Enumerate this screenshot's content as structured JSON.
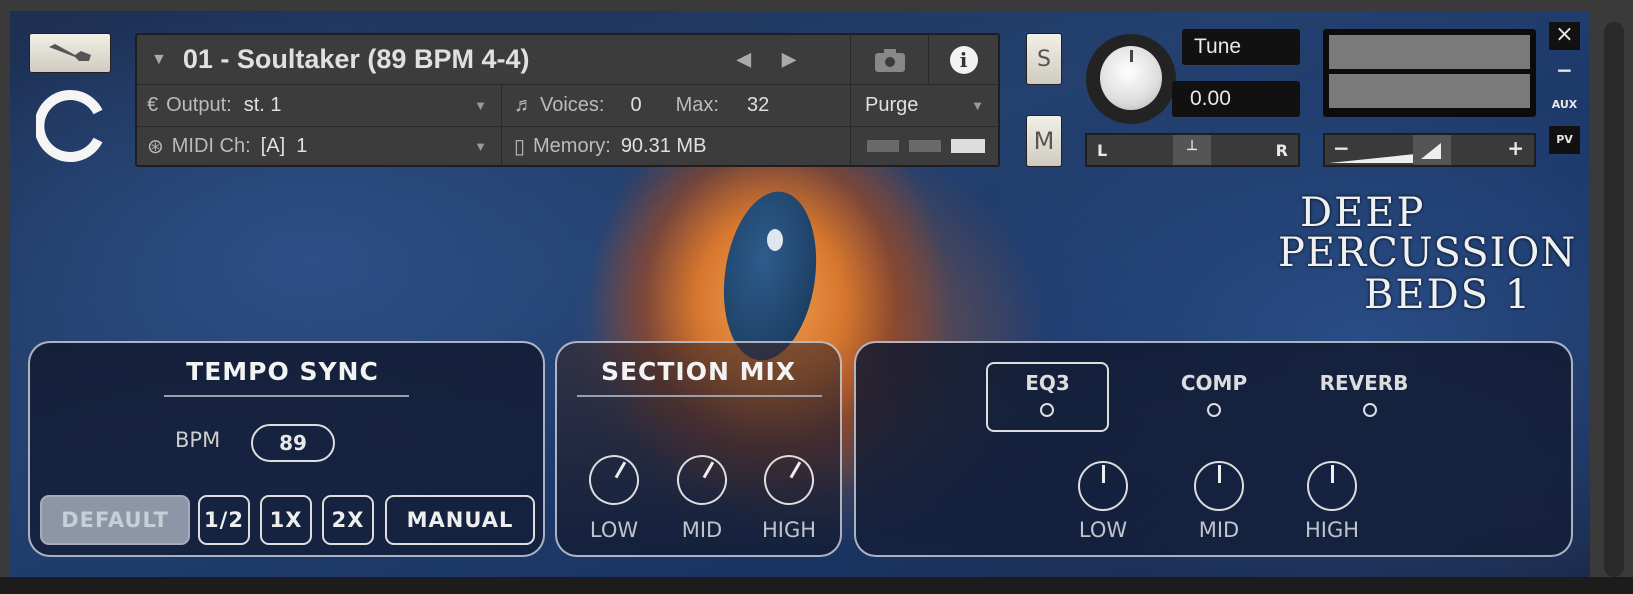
{
  "header": {
    "preset": "01 - Soultaker (89 BPM 4-4)",
    "output_label": "Output:",
    "output_value": "st. 1",
    "voices_label": "Voices:",
    "voices_value": "0",
    "max_label": "Max:",
    "max_value": "32",
    "purge": "Purge",
    "midi_label": "MIDI Ch:",
    "midi_value": "[A]  1",
    "memory_label": "Memory:",
    "memory_value": "90.31 MB"
  },
  "controls": {
    "solo": "S",
    "mute": "M",
    "tune_label": "Tune",
    "tune_value": "0.00",
    "pan_left": "L",
    "pan_right": "R",
    "vol_minus": "−",
    "vol_plus": "+",
    "close": "×",
    "minimize": "−",
    "aux": "AUX",
    "pv": "PV"
  },
  "logo": {
    "line1": "DEEP",
    "line2": "PERCUSSION",
    "line3": "BEDS 1"
  },
  "tempo": {
    "title": "TEMPO SYNC",
    "bpm_label": "BPM",
    "bpm_value": "89",
    "buttons": [
      "DEFAULT",
      "1/2",
      "1X",
      "2X",
      "MANUAL"
    ],
    "active": "DEFAULT"
  },
  "section_mix": {
    "title": "SECTION MIX",
    "knobs": [
      "LOW",
      "MID",
      "HIGH"
    ]
  },
  "fx": {
    "tabs": [
      "EQ3",
      "COMP",
      "REVERB"
    ],
    "active": "EQ3",
    "knobs": [
      "LOW",
      "MID",
      "HIGH"
    ]
  }
}
